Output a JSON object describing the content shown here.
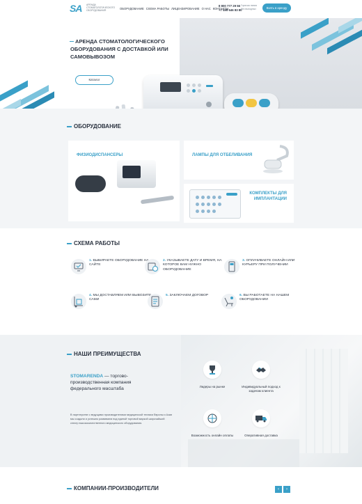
{
  "header": {
    "logo": "SA",
    "logo_text": "аренда стоматологического оборудования",
    "nav": [
      "Оборудование",
      "Схема работы",
      "Лицензирование",
      "О нас",
      "Контакты"
    ],
    "phones": [
      "8 800 777 29 56",
      "+7 495 646 83 80"
    ],
    "hours": [
      "Горячая линия",
      "без выходных"
    ],
    "cta_label": "Взять в аренду"
  },
  "hero": {
    "title": "Аренда стоматологического оборудования с доставкой или самовывозом",
    "more_label": "Каталог"
  },
  "equipment": {
    "title": "Оборудование",
    "cards": [
      {
        "label": "Физиодиспансеры"
      },
      {
        "label": "Лампы для отбеливания"
      },
      {
        "label": "Комплекты для имплантации"
      }
    ]
  },
  "scheme": {
    "title": "Схема работы",
    "steps": [
      {
        "num": "1.",
        "text": "Выбираете оборудование на сайте"
      },
      {
        "num": "2.",
        "text": "Указываете дату и время, на которое вам нужно оборудование"
      },
      {
        "num": "3.",
        "text": "Оплачиваете онлайн или курьеру при получении"
      },
      {
        "num": "4.",
        "text": "Мы доставляем или вывозите сами"
      },
      {
        "num": "5.",
        "text": "Заключаем договор"
      },
      {
        "num": "6.",
        "text": "Вы работаете на нашем оборудовании"
      }
    ]
  },
  "advantages": {
    "title": "Наши преимущества",
    "brand": "STOMARENDA",
    "lead": " — торгово-производственная компания федерального масштаба",
    "body": "В партнерстве с ведущими производителями медицинской техники Европы и Азии мы создали и успешно развиваем под единой торговой маркой широчайший спектр высококачественного медицинского оборудования.",
    "items": [
      {
        "label": "Лидеры на рынке",
        "icon": "trophy-icon"
      },
      {
        "label": "Индивидуальный подход к задачам клиента",
        "icon": "handshake-icon"
      },
      {
        "label": "Возможность онлайн оплаты",
        "icon": "globe-icon"
      },
      {
        "label": "Оперативная доставка",
        "icon": "truck-icon"
      }
    ]
  },
  "companies": {
    "title": "Компании-производители",
    "prev": "‹",
    "next": "›"
  },
  "colors": {
    "accent": "#3aa0c8",
    "dark": "#2b3340"
  }
}
